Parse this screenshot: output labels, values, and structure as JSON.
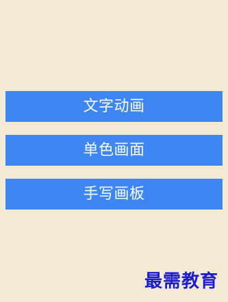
{
  "colors": {
    "background": "#f5ead3",
    "button": "#3d86f4",
    "button_text": "#ffffff",
    "watermark": "#1b1bd0"
  },
  "menu": {
    "items": [
      {
        "label": "文字动画"
      },
      {
        "label": "单色画面"
      },
      {
        "label": "手写画板"
      }
    ]
  },
  "watermark": {
    "text": "最需教育"
  }
}
